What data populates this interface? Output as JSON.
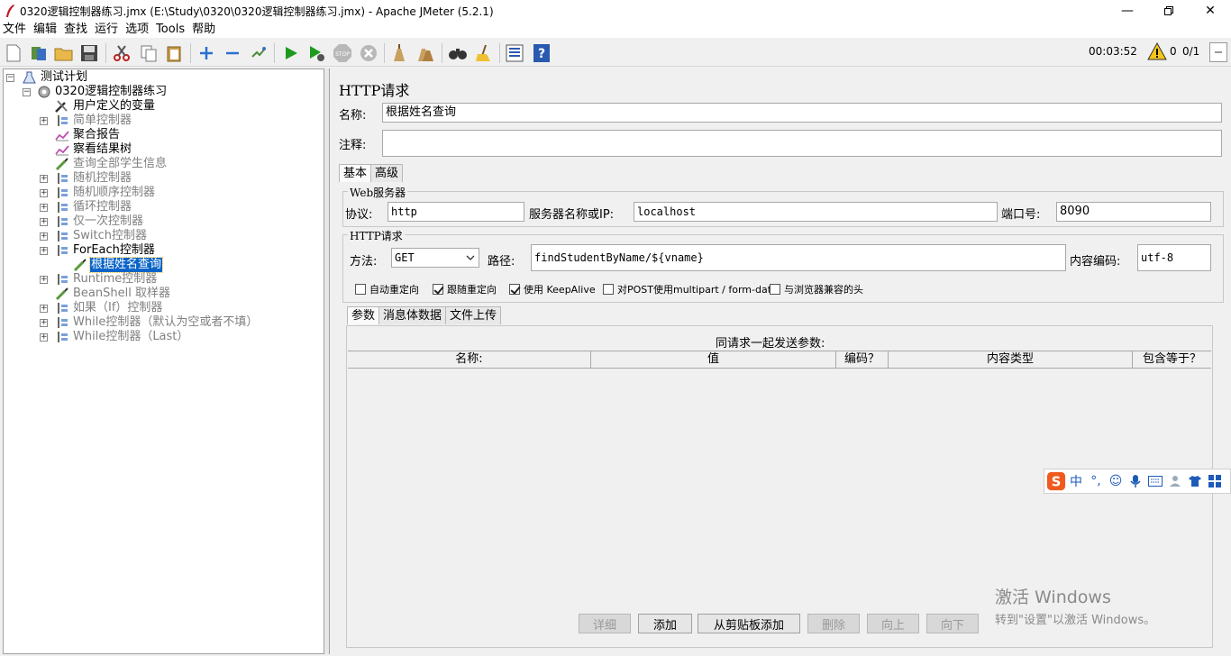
{
  "window": {
    "title": "0320逻辑控制器练习.jmx (E:\\Study\\0320\\0320逻辑控制器练习.jmx) - Apache JMeter (5.2.1)"
  },
  "menu": [
    "文件",
    "编辑",
    "查找",
    "运行",
    "选项",
    "Tools",
    "帮助"
  ],
  "status": {
    "elapsed": "00:03:52",
    "warnings": "0",
    "threads": "0/1"
  },
  "tree": {
    "root": "测试计划",
    "plan": "0320逻辑控制器练习",
    "nodes": [
      {
        "label": "用户定义的变量",
        "icon": "wrench-icon",
        "disabled": false,
        "expander": false
      },
      {
        "label": "简单控制器",
        "icon": "controller-icon",
        "disabled": true,
        "expander": true
      },
      {
        "label": "聚合报告",
        "icon": "chart-icon",
        "disabled": false,
        "expander": false
      },
      {
        "label": "察看结果树",
        "icon": "chart-icon",
        "disabled": false,
        "expander": false
      },
      {
        "label": "查询全部学生信息",
        "icon": "pipette-icon",
        "disabled": true,
        "expander": false
      },
      {
        "label": "随机控制器",
        "icon": "controller-icon",
        "disabled": true,
        "expander": true
      },
      {
        "label": "随机顺序控制器",
        "icon": "controller-icon",
        "disabled": true,
        "expander": true
      },
      {
        "label": "循环控制器",
        "icon": "controller-icon",
        "disabled": true,
        "expander": true
      },
      {
        "label": "仅一次控制器",
        "icon": "controller-icon",
        "disabled": true,
        "expander": true
      },
      {
        "label": "Switch控制器",
        "icon": "controller-icon",
        "disabled": true,
        "expander": true
      },
      {
        "label": "ForEach控制器",
        "icon": "controller-icon",
        "disabled": false,
        "expander": true
      },
      {
        "label": "根据姓名查询",
        "icon": "pipette-icon",
        "disabled": false,
        "expander": false,
        "selected": true
      },
      {
        "label": "Runtime控制器",
        "icon": "controller-icon",
        "disabled": true,
        "expander": true
      },
      {
        "label": "BeanShell 取样器",
        "icon": "pipette-icon",
        "disabled": true,
        "expander": false
      },
      {
        "label": "如果（If）控制器",
        "icon": "controller-icon",
        "disabled": true,
        "expander": true
      },
      {
        "label": "While控制器（默认为空或者不填）",
        "icon": "controller-icon",
        "disabled": true,
        "expander": true
      },
      {
        "label": "While控制器（Last）",
        "icon": "controller-icon",
        "disabled": true,
        "expander": true
      }
    ]
  },
  "http": {
    "panel_title": "HTTP请求",
    "name_label": "名称:",
    "name_value": "根据姓名查询",
    "comment_label": "注释:",
    "comment_value": "",
    "tab_basic": "基本",
    "tab_advanced": "高级",
    "web_server_group": "Web服务器",
    "protocol_label": "协议:",
    "protocol_value": "http",
    "server_label": "服务器名称或IP:",
    "server_value": "localhost",
    "port_label": "端口号:",
    "port_value": "8090",
    "request_group": "HTTP请求",
    "method_label": "方法:",
    "method_value": "GET",
    "path_label": "路径:",
    "path_value": "findStudentByName/${vname}",
    "encoding_label": "内容编码:",
    "encoding_value": "utf-8",
    "checkboxes": [
      {
        "label": "自动重定向",
        "checked": false
      },
      {
        "label": "跟随重定向",
        "checked": true
      },
      {
        "label": "使用 KeepAlive",
        "checked": true
      },
      {
        "label": "对POST使用multipart / form-data",
        "checked": false
      },
      {
        "label": "与浏览器兼容的头",
        "checked": false
      }
    ],
    "sub_tabs": [
      "参数",
      "消息体数据",
      "文件上传"
    ],
    "params_caption": "同请求一起发送参数:",
    "columns": [
      "名称:",
      "值",
      "编码？",
      "内容类型",
      "包含等于？"
    ],
    "buttons": {
      "detail": "详细",
      "add": "添加",
      "add_clipboard": "从剪贴板添加",
      "delete": "删除",
      "up": "向上",
      "down": "向下"
    }
  },
  "ime": {
    "mode": "中"
  },
  "activation": {
    "line1": "激活 Windows",
    "line2": "转到\"设置\"以激活 Windows。"
  }
}
